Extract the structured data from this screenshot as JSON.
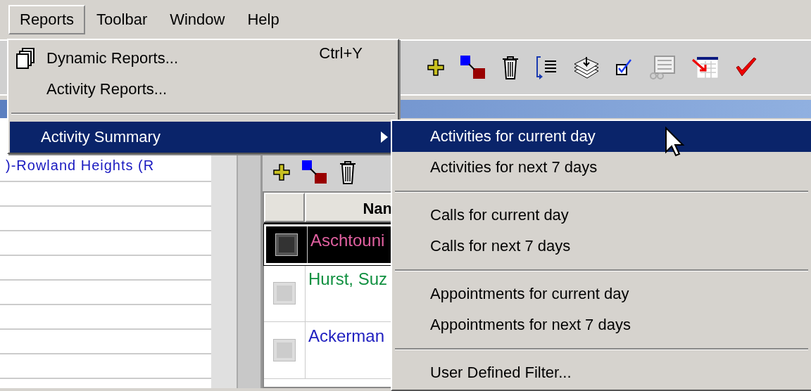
{
  "menubar": [
    {
      "label": "Reports",
      "selected": true
    },
    {
      "label": "Toolbar",
      "selected": false
    },
    {
      "label": "Window",
      "selected": false
    },
    {
      "label": "Help",
      "selected": false
    }
  ],
  "reports_menu": [
    {
      "kind": "icon_item",
      "label": "Dynamic Reports...",
      "shortcut": "Ctrl+Y",
      "selected": false
    },
    {
      "kind": "item",
      "label": "Activity Reports...",
      "selected": false
    },
    {
      "kind": "separator"
    },
    {
      "kind": "submenu",
      "label": "Activity Summary",
      "selected": true
    }
  ],
  "activity_summary_menu": [
    {
      "kind": "item",
      "label": "Activities for current day",
      "selected": true
    },
    {
      "kind": "item",
      "label": "Activities for next 7 days",
      "selected": false
    },
    {
      "kind": "separator"
    },
    {
      "kind": "item",
      "label": "Calls for current day",
      "selected": false
    },
    {
      "kind": "item",
      "label": "Calls for next 7 days",
      "selected": false
    },
    {
      "kind": "separator"
    },
    {
      "kind": "item",
      "label": "Appointments for current day",
      "selected": false
    },
    {
      "kind": "item",
      "label": "Appointments for next 7 days",
      "selected": false
    },
    {
      "kind": "separator"
    },
    {
      "kind": "item",
      "label": "User Defined Filter...",
      "selected": false
    }
  ],
  "left_list": {
    "rows": [
      ")-Rowland Heights (R"
    ]
  },
  "grid": {
    "columns": [
      {
        "label": "Nan"
      }
    ],
    "rows": [
      {
        "name": "Aschtouni",
        "color": "#e060a0",
        "selected": true
      },
      {
        "name": "Hurst, Suz",
        "color": "#109040",
        "selected": false
      },
      {
        "name": "Ackerman",
        "color": "#2020c0",
        "selected": false
      }
    ]
  }
}
